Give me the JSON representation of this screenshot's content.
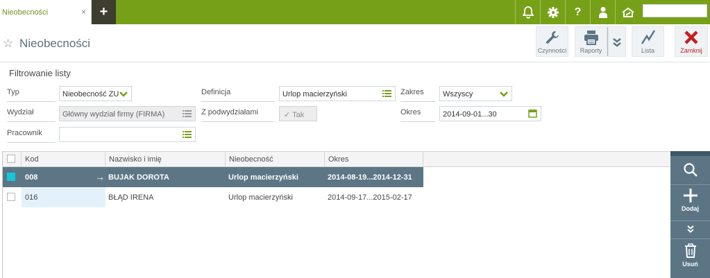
{
  "topbar": {
    "tab_label": "Nieobecności",
    "tab_close": "×",
    "add_tab": "+",
    "icons": [
      "bell-icon",
      "gear-icon",
      "help-icon",
      "user-icon",
      "home-icon"
    ],
    "search_value": ""
  },
  "header": {
    "title": "Nieobecności"
  },
  "toolbar": {
    "actions_label": "Czynności",
    "reports_label": "Raporty",
    "list_label": "Lista",
    "close_label": "Zamknij"
  },
  "filter": {
    "title": "Filtrowanie listy",
    "typ_label": "Typ",
    "typ_value": "Nieobecność ZU",
    "definicja_label": "Definicja",
    "definicja_value": "Urlop macierzyński",
    "zakres_label": "Zakres",
    "zakres_value": "Wszyscy",
    "wydzial_label": "Wydział",
    "wydzial_value": "Główny wydział firmy (FIRMA)",
    "podwydzialy_label": "Z podwydziałami",
    "podwydzialy_value": "Tak",
    "okres_label": "Okres",
    "okres_value": "2014-09-01...30",
    "pracownik_label": "Pracownik",
    "pracownik_value": ""
  },
  "grid": {
    "columns": [
      "Kod",
      "Nazwisko i imię",
      "Nieobecność",
      "Okres"
    ],
    "rows": [
      {
        "kod": "008",
        "name": "BUJAK DOROTA",
        "type": "Urlop macierzyński",
        "period": "2014-08-19...2014-12-31",
        "selected": true
      },
      {
        "kod": "016",
        "name": "BŁĄD IRENA",
        "type": "Urlop macierzyński",
        "period": "2014-09-17...2015-02-17",
        "selected": false
      }
    ]
  },
  "side_panel": {
    "add_label": "Dodaj",
    "delete_label": "Usuń"
  },
  "colors": {
    "brand_green": "#77a019",
    "selected_row": "#5c7686",
    "close_red": "#c41f1f"
  }
}
